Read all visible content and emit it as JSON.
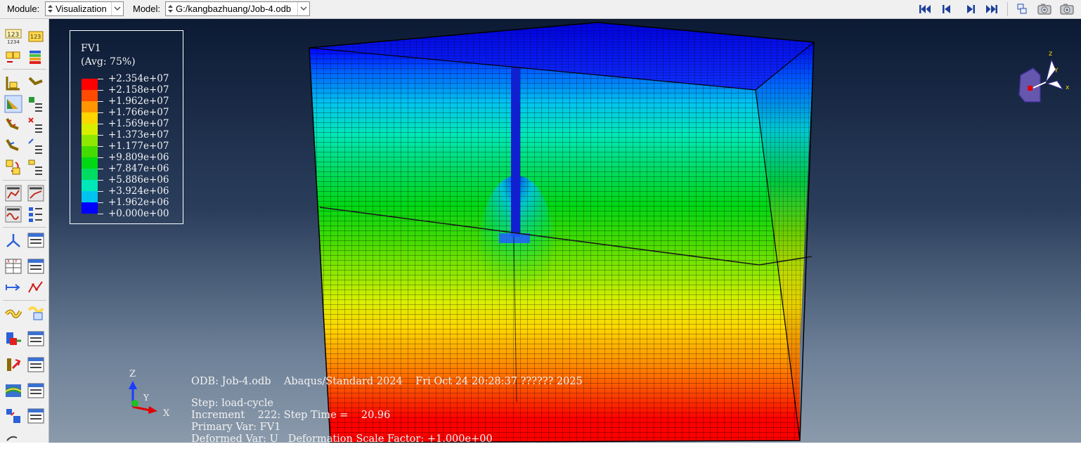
{
  "toolbar": {
    "module_label": "Module:",
    "module_value": "Visualization",
    "model_label": "Model:",
    "model_value": "G:/kangbazhuang/Job-4.odb",
    "icons": [
      "first-frame-icon",
      "previous-frame-icon",
      "next-frame-icon",
      "last-frame-icon",
      "viewport-tile-icon",
      "camera-icon",
      "camera-icon"
    ]
  },
  "legend": {
    "title": "FV1",
    "averaging": "(Avg: 75%)",
    "levels": [
      {
        "value": "+2.354e+07",
        "color": "#ff0000"
      },
      {
        "value": "+2.158e+07",
        "color": "#ff4a00"
      },
      {
        "value": "+1.962e+07",
        "color": "#ff9500"
      },
      {
        "value": "+1.766e+07",
        "color": "#ffd600"
      },
      {
        "value": "+1.569e+07",
        "color": "#d8f000"
      },
      {
        "value": "+1.373e+07",
        "color": "#8ee800"
      },
      {
        "value": "+1.177e+07",
        "color": "#44dc00"
      },
      {
        "value": "+9.809e+06",
        "color": "#00d814"
      },
      {
        "value": "+7.847e+06",
        "color": "#00dc62"
      },
      {
        "value": "+5.886e+06",
        "color": "#00e8b8"
      },
      {
        "value": "+3.924e+06",
        "color": "#00c4f0"
      },
      {
        "value": "+1.962e+06",
        "color": "#0060ff"
      },
      {
        "value": "+0.000e+00",
        "color": "#0000ff"
      }
    ]
  },
  "info": {
    "odb_line": "ODB: Job-4.odb    Abaqus/Standard 2024    Fri Oct 24 20:28:37 ?????? 2025",
    "step_line": "Step: load-cycle",
    "increment_line": "Increment    222: Step Time =    20.96",
    "primary_line": "Primary Var: FV1",
    "deformed_line": "Deformed Var: U   Deformation Scale Factor: +1.000e+00"
  },
  "triad": {
    "z": "Z",
    "y": "Y",
    "x": "X"
  },
  "view_triad": {
    "z": "z",
    "y": "Y",
    "x": "x"
  }
}
